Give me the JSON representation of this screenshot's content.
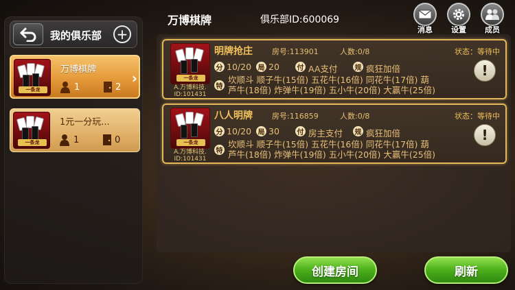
{
  "sidebar": {
    "title": "我的俱乐部",
    "clubs": [
      {
        "name": "万博棋牌",
        "members": "1",
        "rooms": "2",
        "active": true
      },
      {
        "name": "1元一分玩...",
        "members": "1",
        "rooms": "0",
        "active": false
      }
    ]
  },
  "header": {
    "club_name": "万博棋牌",
    "club_id": "俱乐部ID:600069",
    "buttons": {
      "message": "消息",
      "settings": "设置",
      "members": "成员"
    }
  },
  "rooms": [
    {
      "name": "明牌抢庄",
      "room_no": "房号:113901",
      "count": "人数:0/8",
      "status": "状态：等待中",
      "score": "10/20",
      "rounds": "20",
      "pay": "AA支付",
      "rule": "疯狂加倍",
      "desc_line1": "坎顺斗 顺子牛(15倍) 五花牛(16倍) 同花牛(17倍) 葫",
      "desc_line2": "芦牛(18倍) 炸弹牛(19倍) 五小牛(20倍) 大赢牛(25倍)",
      "creator": "A.万博科技.",
      "creator_id": "ID:101431"
    },
    {
      "name": "八人明牌",
      "room_no": "房号:116859",
      "count": "人数:0/8",
      "status": "状态：等待中",
      "score": "10/20",
      "rounds": "30",
      "pay": "房主支付",
      "rule": "疯狂加倍",
      "desc_line1": "坎顺斗 顺子牛(15倍) 五花牛(16倍) 同花牛(17倍) 葫",
      "desc_line2": "芦牛(18倍) 炸弹牛(19倍) 五小牛(20倍) 大赢牛(25倍)",
      "creator": "A.万博科技.",
      "creator_id": "ID:101431"
    }
  ],
  "tags": {
    "score": "分",
    "rounds": "局",
    "pay": "付",
    "rule": "规",
    "special": "特"
  },
  "thumb_banner": "一条龙",
  "footer": {
    "create_room": "创建房间",
    "refresh": "刷新"
  }
}
